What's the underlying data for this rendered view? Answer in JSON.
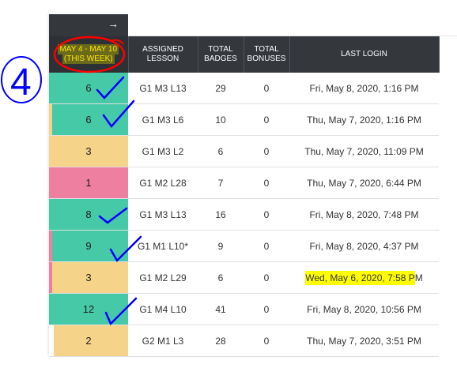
{
  "topbar": {
    "collapse_icon": "arrow-right-icon"
  },
  "headers": {
    "week_line1": "MAY 4 - MAY 10",
    "week_line2": "(THIS WEEK)",
    "assigned_lesson": "ASSIGNED LESSON",
    "total_badges": "TOTAL BADGES",
    "total_bonuses": "TOTAL BONUSES",
    "last_login": "LAST LOGIN"
  },
  "rows": [
    {
      "score": "6",
      "color": "green",
      "lesson": "G1 M3 L13",
      "badges": "29",
      "bonuses": "0",
      "last_login": "Fri, May 8, 2020, 1:16 PM"
    },
    {
      "score": "6",
      "color": "green",
      "lesson": "G1 M3 L6",
      "badges": "10",
      "bonuses": "0",
      "last_login": "Thu, May 7, 2020, 1:16 PM"
    },
    {
      "score": "3",
      "color": "yellow",
      "lesson": "G1 M3 L2",
      "badges": "6",
      "bonuses": "0",
      "last_login": "Thu, May 7, 2020, 11:09 PM"
    },
    {
      "score": "1",
      "color": "pink",
      "lesson": "G1 M2 L28",
      "badges": "7",
      "bonuses": "0",
      "last_login": "Thu, May 7, 2020, 6:44 PM"
    },
    {
      "score": "8",
      "color": "green",
      "lesson": "G1 M3 L13",
      "badges": "16",
      "bonuses": "0",
      "last_login": "Fri, May 8, 2020, 7:48 PM"
    },
    {
      "score": "9",
      "color": "green",
      "lesson": "G1 M1 L10*",
      "badges": "9",
      "bonuses": "0",
      "last_login": "Fri, May 8, 2020, 4:37 PM"
    },
    {
      "score": "3",
      "color": "yellow",
      "lesson": "G1 M2 L29",
      "badges": "6",
      "bonuses": "0",
      "last_login_highlighted": "Wed, May 6, 2020, 7:58 P",
      "last_login_rest": "M"
    },
    {
      "score": "12",
      "color": "green",
      "lesson": "G1 M4 L10",
      "badges": "41",
      "bonuses": "0",
      "last_login": "Fri, May 8, 2020, 10:56 PM"
    },
    {
      "score": "2",
      "color": "yellow",
      "lesson": "G2 M1 L3",
      "badges": "28",
      "bonuses": "0",
      "last_login": "Thu, May 7, 2020, 3:51 PM"
    }
  ],
  "annotations": {
    "circled_number": "4",
    "ink_color": "#0000ff",
    "circle_color": "#ff0000",
    "highlight_color": "#ffff00"
  },
  "colors": {
    "green": "#46c9a7",
    "yellow": "#f5d48a",
    "pink": "#ef7fa1",
    "header_bg": "#34383d"
  }
}
